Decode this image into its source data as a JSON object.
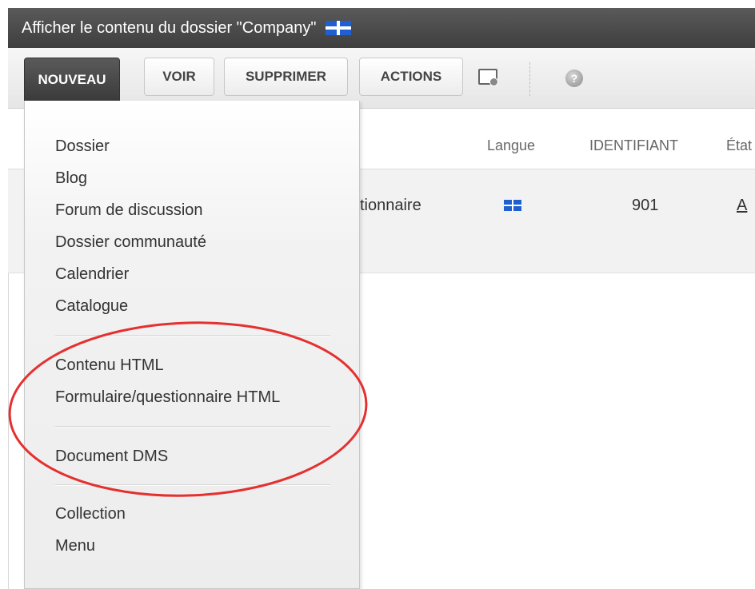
{
  "window": {
    "title": "Afficher le contenu du dossier \"Company\""
  },
  "toolbar": {
    "buttons": [
      {
        "label": "NOUVEAU",
        "active": true
      },
      {
        "label": "VOIR",
        "active": false
      },
      {
        "label": "SUPPRIMER",
        "active": false
      },
      {
        "label": "ACTIONS",
        "active": false
      }
    ],
    "icons": [
      "window-preview-icon",
      "help-icon"
    ]
  },
  "table": {
    "headers": {
      "language": "Langue",
      "identifier": "IDENTIFIANT",
      "state": "État"
    },
    "rows": [
      {
        "title_fragment": "stionnaire",
        "id": "901",
        "state": "A"
      }
    ]
  },
  "dropdown": {
    "groups": [
      [
        "Dossier",
        "Blog",
        "Forum de discussion",
        "Dossier communauté",
        "Calendrier",
        "Catalogue"
      ],
      [
        "Contenu HTML",
        "Formulaire/questionnaire HTML"
      ],
      [
        "Document DMS"
      ],
      [
        "Collection",
        "Menu"
      ]
    ]
  },
  "colors": {
    "titlebar": "#4a4a4a",
    "annotation": "#e53030",
    "quebec_flag": "#1f5fd0"
  }
}
